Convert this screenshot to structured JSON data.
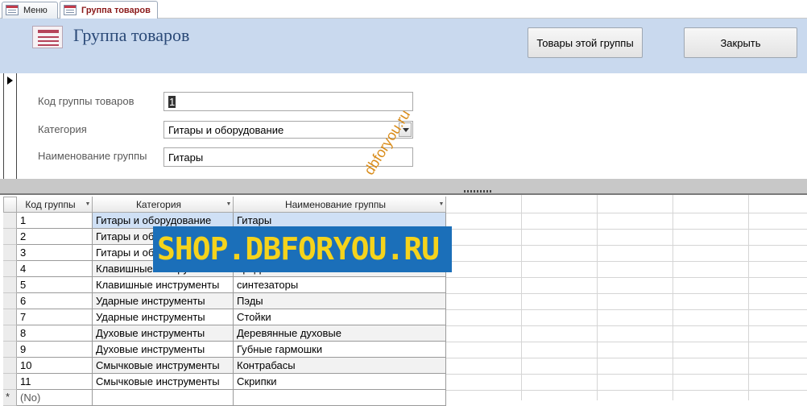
{
  "tabs": [
    {
      "label": "Меню",
      "active": false
    },
    {
      "label": "Группа товаров",
      "active": true
    }
  ],
  "header": {
    "title": "Группа товаров",
    "btn_group_items": "Товары этой группы",
    "btn_close": "Закрыть"
  },
  "form": {
    "code_label": "Код группы товаров",
    "code_value": "1",
    "category_label": "Категория",
    "category_value": "Гитары и оборудование",
    "name_label": "Наименование группы",
    "name_value": "Гитары"
  },
  "table": {
    "headers": [
      "Код группы",
      "Категория",
      "Наименование группы"
    ],
    "rows": [
      {
        "code": "1",
        "category": "Гитары и оборудование",
        "name": "Гитары"
      },
      {
        "code": "2",
        "category": "Гитары и об",
        "name": ""
      },
      {
        "code": "3",
        "category": "Гитары и об",
        "name": ""
      },
      {
        "code": "4",
        "category": "Клавишные инструменты",
        "name": "Цифровые пианино"
      },
      {
        "code": "5",
        "category": "Клавишные инструменты",
        "name": "синтезаторы"
      },
      {
        "code": "6",
        "category": "Ударные инструменты",
        "name": "Пэды"
      },
      {
        "code": "7",
        "category": "Ударные инструменты",
        "name": "Стойки"
      },
      {
        "code": "8",
        "category": "Духовые инструменты",
        "name": "Деревянные духовые"
      },
      {
        "code": "9",
        "category": "Духовые инструменты",
        "name": "Губные гармошки"
      },
      {
        "code": "10",
        "category": "Смычковые инструменты",
        "name": "Контрабасы"
      },
      {
        "code": "11",
        "category": "Смычковые инструменты",
        "name": "Скрипки"
      }
    ],
    "new_row_code": "(No)",
    "new_row_mark": "*"
  },
  "watermark": {
    "banner": "SHOP.DBFORYOU.RU",
    "diagonal": "dbforyou.ru"
  },
  "colors": {
    "header_bg": "#c9d9ee",
    "title": "#2b4a78",
    "active_tab": "#8b1a1a",
    "selected_row": "#cfe0f5",
    "banner_bg": "#1b6fb9",
    "banner_text": "#f5d31c"
  }
}
